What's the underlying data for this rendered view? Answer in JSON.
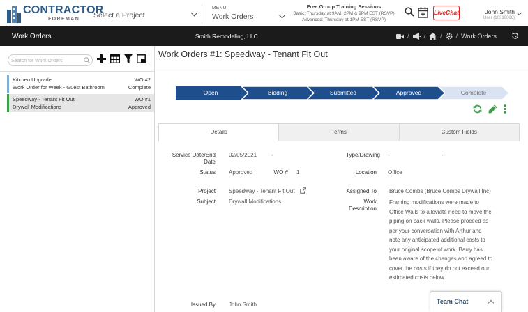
{
  "header": {
    "logo_word1": "CONTRACTOR",
    "logo_word2": "FOREMAN",
    "project_select": "Select a Project",
    "menu_label": "MENU",
    "menu_value": "Work Orders",
    "training_title": "Free Group Training Sessions",
    "training_basic": "Basic: Thursday at 9AM, 2PM & 9PM EST (RSVP)",
    "training_advanced": "Advanced: Thursday at 1PM EST (RSVP)",
    "livechat": "LiveChat",
    "user_name": "John Smith",
    "user_id": "User (10316086)"
  },
  "navbar": {
    "module": "Work Orders",
    "company": "Smith Remodeling, LLC",
    "breadcrumb_current": "Work Orders"
  },
  "left_panel": {
    "search_placeholder": "Search for Work Orders",
    "items": [
      {
        "title": "Kitchen Upgrade",
        "wo": "WO #2",
        "subtitle": "Work Order for Week - Guest Bathroom",
        "status": "Complete"
      },
      {
        "title": "Speedway - Tenant Fit Out",
        "wo": "WO #1",
        "subtitle": "Drywall Modifications",
        "status": "Approved"
      }
    ]
  },
  "main": {
    "title": "Work Orders #1: Speedway - Tenant Fit Out",
    "steps": [
      "Open",
      "Bidding",
      "Submitted",
      "Approved",
      "Complete"
    ],
    "tabs": [
      "Details",
      "Terms",
      "Custom Fields"
    ],
    "details": {
      "service_date_label": "Service Date/End Date",
      "service_date_value": "02/05/2021",
      "service_date_end": "-",
      "type_label": "Type/Drawing",
      "type_value": "-",
      "type_value2": "-",
      "status_label": "Status",
      "status_value": "Approved",
      "wo_label": "WO #",
      "wo_value": "1",
      "location_label": "Location",
      "location_value": "Office",
      "project_label": "Project",
      "project_value": "Speedway - Tenant Fit Out",
      "assigned_label": "Assigned To",
      "assigned_value": "Bruce Combs (Bruce Combs Drywall Inc)",
      "subject_label": "Subject",
      "subject_value": "Drywall Modifications",
      "work_desc_label": "Work Description",
      "work_desc_value": "Framing modifications were made to Office Walls to alleviate need to move the piping on back walls.  Please proceed as per your conversation with Arthur and note any anticipated additional costs to your original scope of work.  Barry has been aware of the changes and agreed to cover the costs if they do not exceed our estimated costs below.",
      "issued_label": "Issued By",
      "issued_value": "John Smith"
    }
  },
  "team_chat": "Team Chat",
  "colors": {
    "brand_blue": "#2f5b87",
    "step_active": "#1f4e8c",
    "step_todo": "#d9e3f2",
    "action_green": "#3aa14a",
    "nav_dark": "#1b1b1b"
  }
}
